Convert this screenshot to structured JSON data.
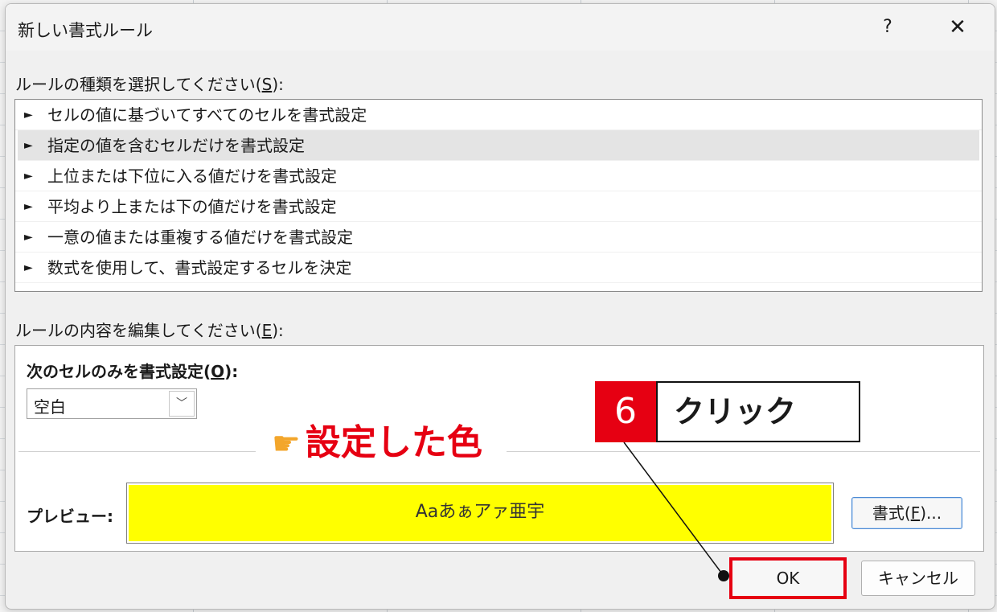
{
  "dialog": {
    "title": "新しい書式ルール",
    "help_label": "?",
    "close_label": "✕"
  },
  "rule_type": {
    "label_prefix": "ルールの種類を選択してください(",
    "label_key": "S",
    "label_suffix": "):",
    "items": [
      {
        "label": "セルの値に基づいてすべてのセルを書式設定",
        "selected": false
      },
      {
        "label": "指定の値を含むセルだけを書式設定",
        "selected": true
      },
      {
        "label": "上位または下位に入る値だけを書式設定",
        "selected": false
      },
      {
        "label": "平均より上または下の値だけを書式設定",
        "selected": false
      },
      {
        "label": "一意の値または重複する値だけを書式設定",
        "selected": false
      },
      {
        "label": "数式を使用して、書式設定するセルを決定",
        "selected": false
      }
    ],
    "arrow_glyph": "►"
  },
  "rule_edit": {
    "label_prefix": "ルールの内容を編集してください(",
    "label_key": "E",
    "label_suffix": "):",
    "format_only_prefix": "次のセルのみを書式設定(",
    "format_only_key": "O",
    "format_only_suffix": "):",
    "selected_option": "空白",
    "preview_label": "プレビュー:",
    "preview_text": "Aaあぁアァ亜宇",
    "preview_fill_color": "#ffff00",
    "format_button_prefix": "書式(",
    "format_button_key": "F",
    "format_button_suffix": ")..."
  },
  "buttons": {
    "ok": "OK",
    "cancel": "キャンセル"
  },
  "annotation": {
    "step_number": "6",
    "step_text": "クリック",
    "note_text": "設定した色",
    "accent_color": "#e60012"
  }
}
